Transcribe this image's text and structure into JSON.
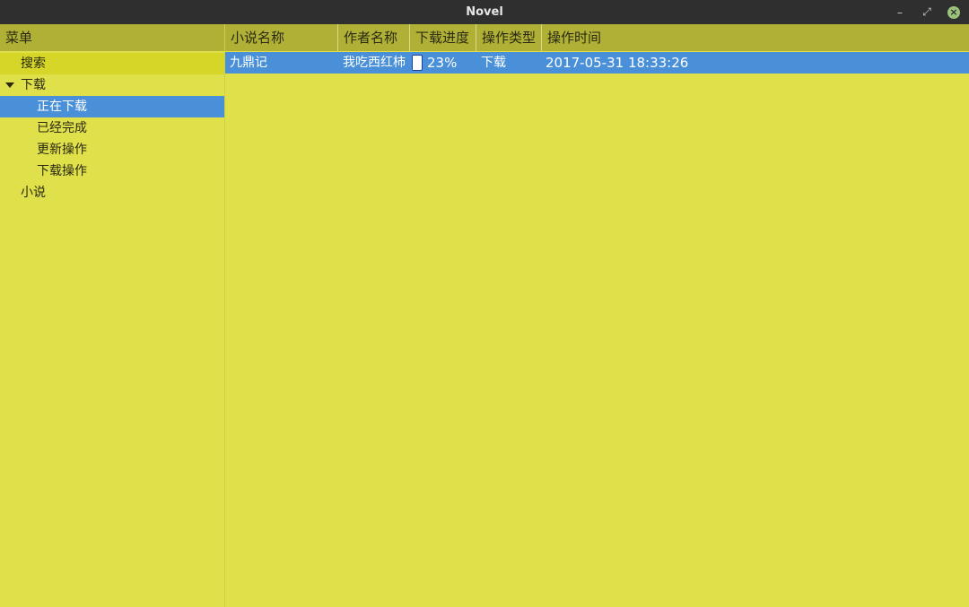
{
  "window": {
    "title": "Novel"
  },
  "sidebar": {
    "header": "菜单",
    "items": [
      {
        "label": "搜索"
      },
      {
        "label": "下载"
      },
      {
        "label": "正在下载"
      },
      {
        "label": "已经完成"
      },
      {
        "label": "更新操作"
      },
      {
        "label": "下载操作"
      },
      {
        "label": "小说"
      }
    ]
  },
  "table": {
    "columns": [
      "小说名称",
      "作者名称",
      "下载进度",
      "操作类型",
      "操作时间"
    ],
    "rows": [
      {
        "name": "九鼎记",
        "author": "我吃西红柿",
        "progress_text": "23%",
        "progress": 0.23,
        "op_type": "下载",
        "time": "2017-05-31 18:33:26"
      }
    ]
  },
  "colors": {
    "background": "#e0e04a",
    "header": "#b0b036",
    "selection": "#4a90d9",
    "titlebar": "#2f2f2f"
  }
}
